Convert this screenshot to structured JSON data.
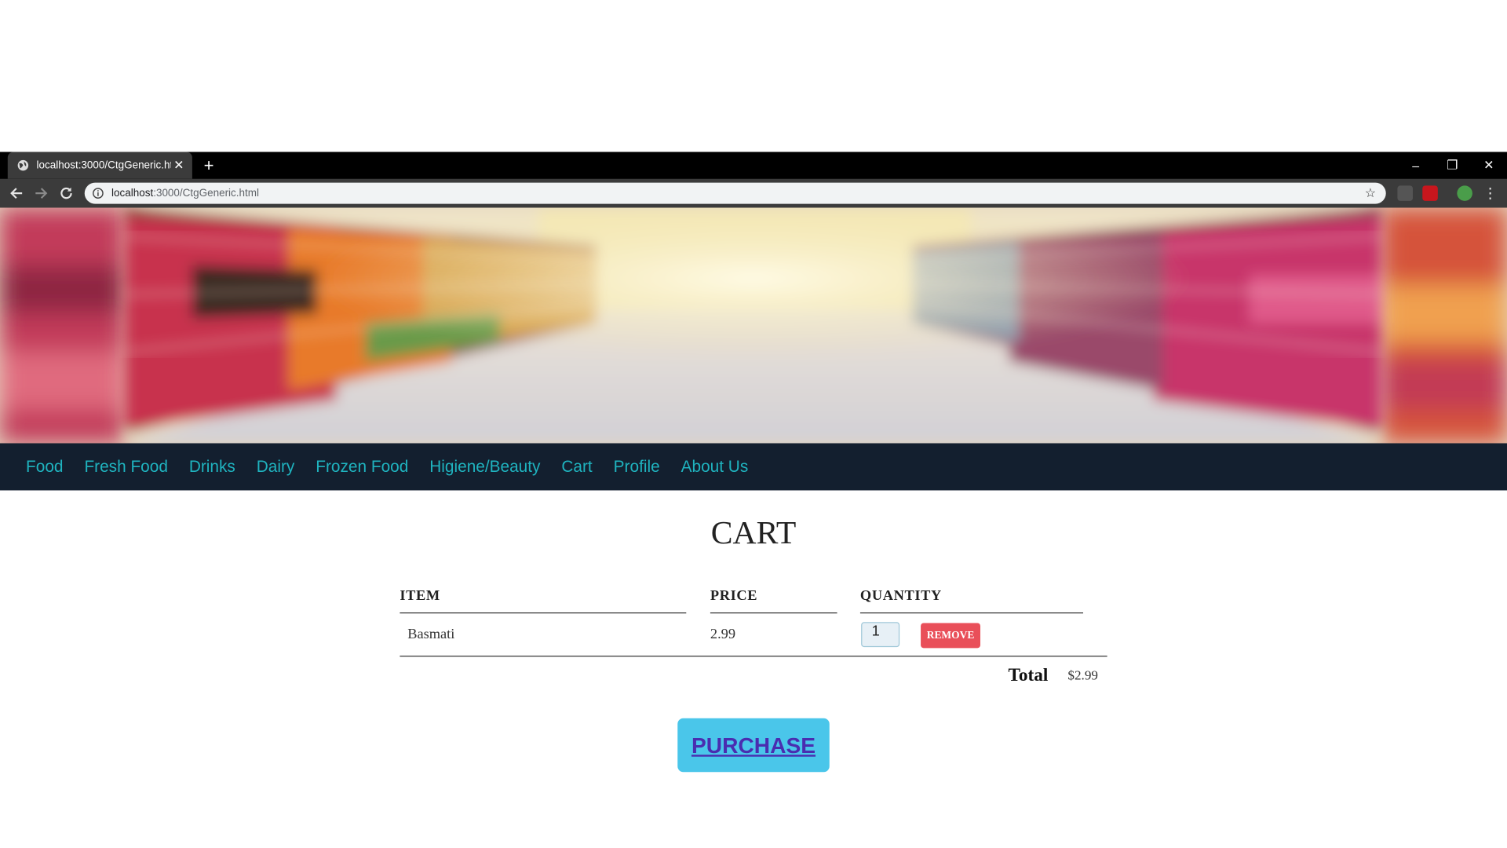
{
  "browser": {
    "tab_title": "localhost:3000/CtgGeneric.html",
    "url_host": "localhost",
    "url_path": ":3000/CtgGeneric.html",
    "new_tab_label": "+",
    "close_tab_label": "✕",
    "icons": [
      "globe-icon",
      "back-icon",
      "forward-icon",
      "reload-icon",
      "info-icon",
      "star-icon",
      "camera-extension-icon",
      "adblock-extension-icon",
      "profile-avatar-icon",
      "menu-icon"
    ]
  },
  "window_controls": {
    "minimize": "–",
    "restore": "❐",
    "close": "✕"
  },
  "nav": {
    "items": [
      "Food",
      "Fresh Food",
      "Drinks",
      "Dairy",
      "Frozen Food",
      "Higiene/Beauty",
      "Cart",
      "Profile",
      "About Us"
    ],
    "color": "#1fb3bf",
    "background": "#131f2f"
  },
  "cart": {
    "title": "CART",
    "headers": {
      "item": "ITEM",
      "price": "PRICE",
      "quantity": "QUANTITY"
    },
    "rows": [
      {
        "item": "Basmati",
        "price": "2.99",
        "quantity": "1",
        "remove_label": "REMOVE"
      }
    ],
    "total_label": "Total",
    "total_value": "$2.99",
    "purchase_label": "PURCHASE"
  },
  "colors": {
    "remove": "#e94f59",
    "purchase": "#4ac6ea",
    "purchase_text": "#4a2db0"
  }
}
